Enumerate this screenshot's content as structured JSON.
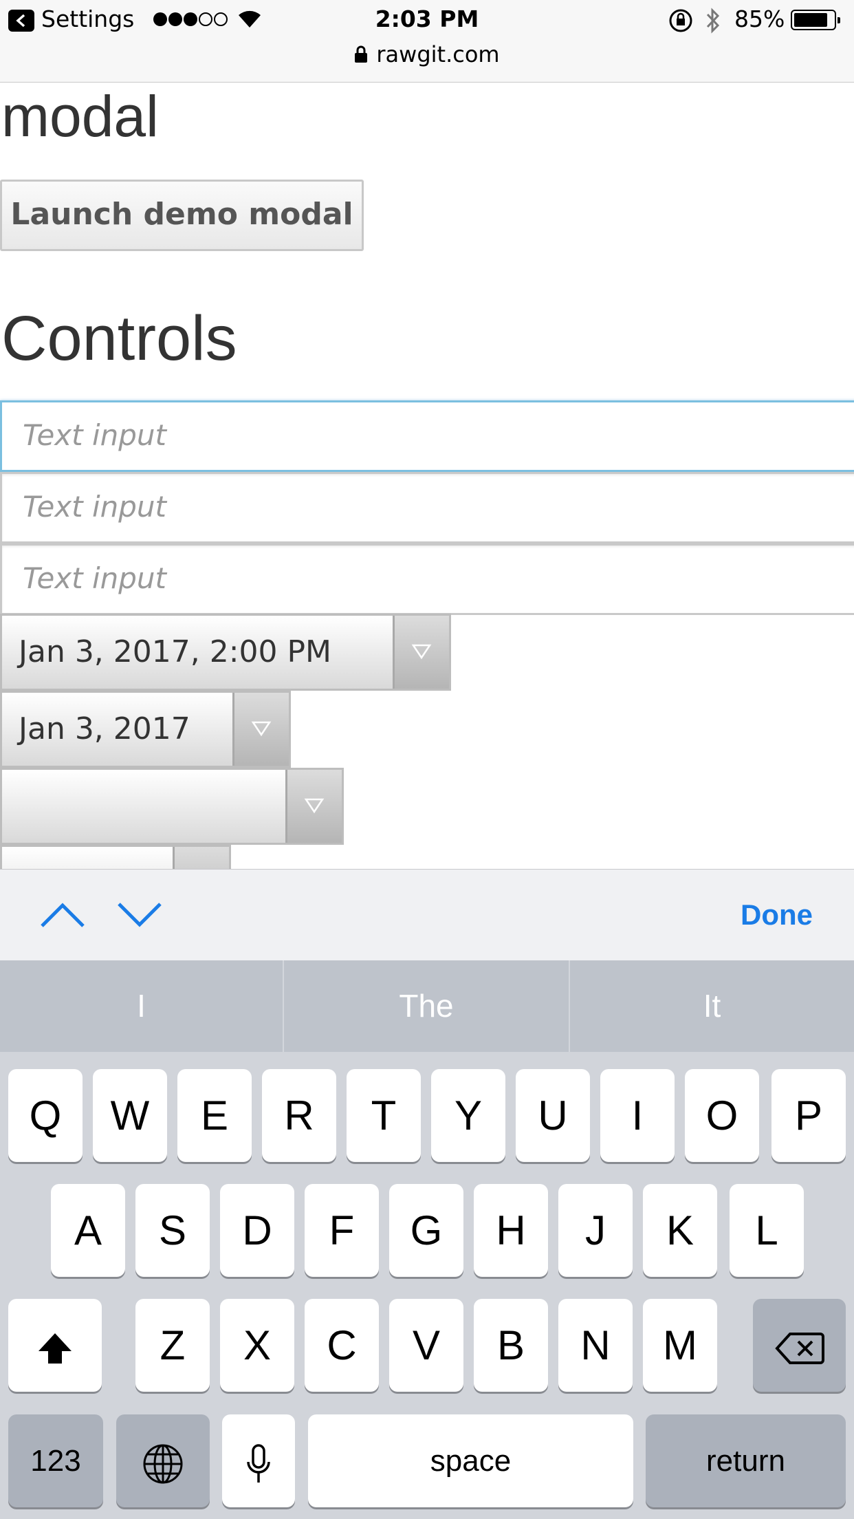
{
  "status_bar": {
    "back_app": "Settings",
    "time": "2:03 PM",
    "battery": "85%",
    "battery_level": 0.85,
    "url": "rawgit.com"
  },
  "page": {
    "modal_heading": "modal",
    "launch_button": "Launch demo modal",
    "controls_heading": "Controls",
    "text_inputs": [
      {
        "placeholder": "Text input"
      },
      {
        "placeholder": "Text input"
      },
      {
        "placeholder": "Text input"
      }
    ],
    "selects": [
      {
        "value": "Jan 3, 2017, 2:00 PM"
      },
      {
        "value": "Jan 3, 2017"
      },
      {
        "value": ""
      },
      {
        "value": ""
      }
    ]
  },
  "accessory": {
    "done_label": "Done"
  },
  "keyboard": {
    "suggestions": [
      "I",
      "The",
      "It"
    ],
    "row1": [
      "Q",
      "W",
      "E",
      "R",
      "T",
      "Y",
      "U",
      "I",
      "O",
      "P"
    ],
    "row2": [
      "A",
      "S",
      "D",
      "F",
      "G",
      "H",
      "J",
      "K",
      "L"
    ],
    "row3": [
      "Z",
      "X",
      "C",
      "V",
      "B",
      "N",
      "M"
    ],
    "numbers_label": "123",
    "space_label": "space",
    "return_label": "return"
  },
  "colors": {
    "accent": "#1a7ce6",
    "focus_border": "#7bbfe0",
    "keyboard_bg": "#d1d4da"
  }
}
